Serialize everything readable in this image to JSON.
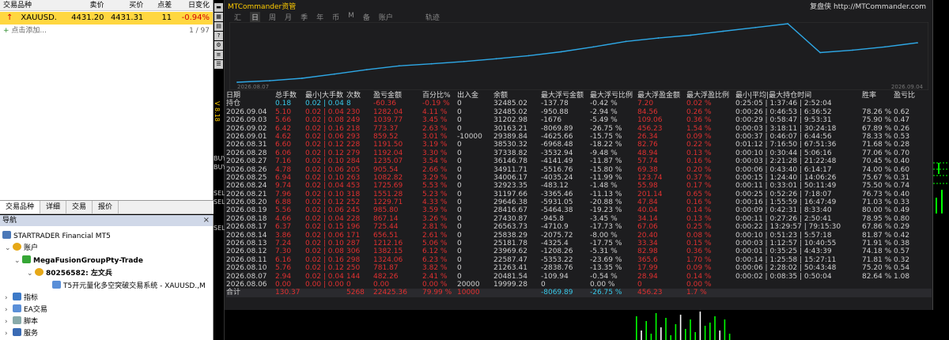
{
  "market_watch": {
    "columns": [
      "交易品种",
      "卖价",
      "买价",
      "点差",
      "日变化"
    ],
    "row": {
      "symbol": "XAUUSD.",
      "bid": "4431.20",
      "ask": "4431.31",
      "spread": "11",
      "change": "-0.94%"
    },
    "add_label": "点击添加...",
    "count": "1 / 97"
  },
  "tabs": [
    "交易品种",
    "详细",
    "交易",
    "报价"
  ],
  "navigator": {
    "title": "导航",
    "broker": "STARTRADER Financial MT5",
    "accounts": "账户",
    "server": "MegaFusionGroupPty-Trade",
    "account": "80256582: 左文兵",
    "ea_attached": "T5开元量化多空突破交易系统 - XAUUSD.,M",
    "indicators": "指标",
    "ea": "EA交易",
    "scripts": "脚本",
    "services": "服务"
  },
  "left_toolbar": {
    "version": "V 8.18",
    "labels": [
      "BUY",
      "BUY",
      "SEL",
      "SEL",
      "SEL"
    ]
  },
  "panel": {
    "title": "MTCommander资管",
    "brand": "复盘侠 http://MTCommander.com",
    "tabs": [
      "汇",
      "日",
      "周",
      "月",
      "季",
      "年",
      "币",
      "M",
      "备",
      "账户",
      "轨迹"
    ],
    "active_tab": "日",
    "curve_start": "2026.08.07",
    "curve_end": "2026.09.04"
  },
  "colors": {
    "accent": "#ffcc00",
    "cyan": "#38c8e8",
    "red": "#e03030",
    "curve": "#2ea8e6",
    "background": "#1d1d1f"
  },
  "chart_data": {
    "type": "line",
    "x": [
      "2026.08.06",
      "2026.08.07",
      "2026.08.10",
      "2026.08.11",
      "2026.08.12",
      "2026.08.13",
      "2026.08.14",
      "2026.08.17",
      "2026.08.18",
      "2026.08.19",
      "2026.08.20",
      "2026.08.21",
      "2026.08.24",
      "2026.08.25",
      "2026.08.26",
      "2026.08.27",
      "2026.08.28",
      "2026.08.31",
      "2026.09.01",
      "2026.09.02",
      "2026.09.03",
      "2026.09.04"
    ],
    "values": [
      19999.28,
      20481.54,
      21263.41,
      22587.47,
      23969.62,
      25181.78,
      25838.29,
      26563.73,
      27430.87,
      28416.67,
      29646.38,
      31197.66,
      32923.35,
      34006.17,
      34911.71,
      36146.78,
      37338.82,
      38530.32,
      29389.84,
      30163.21,
      31202.98,
      32485.02
    ],
    "title": "",
    "xlabel": "",
    "ylabel": ""
  },
  "table": {
    "headers": [
      "日期",
      "总手数",
      "最小|大手数",
      "次数",
      "盈亏金额",
      "百分比%",
      "出入金",
      "余额",
      "最大浮亏金额",
      "最大浮亏比例",
      "最大浮盈金额",
      "最大浮盈比例",
      "最小|平均|最大持仓时间",
      "胜率",
      "盈亏比"
    ],
    "rows": [
      [
        "持仓",
        "0.18",
        "0.02 | 0.04",
        "8",
        "-60.36",
        "-0.19 %",
        "0",
        "32485.02",
        "-137.78",
        "-0.42 %",
        "7.20",
        "0.02 %",
        "0:25:05 | 1:37:46 | 2:52:04",
        "",
        ""
      ],
      [
        "2026.09.04",
        "5.10",
        "0.02 | 0.04",
        "230",
        "1282.04",
        "4.11 %",
        "0",
        "32485.02",
        "-950.88",
        "-2.94 %",
        "84.56",
        "0.26 %",
        "0:00:26 | 0:46:53 | 6:36:52",
        "78.26 %",
        "0.62"
      ],
      [
        "2026.09.03",
        "5.66",
        "0.02 | 0.08",
        "249",
        "1039.77",
        "3.45 %",
        "0",
        "31202.98",
        "-1676",
        "-5.49 %",
        "109.06",
        "0.36 %",
        "0:00:29 | 0:58:47 | 9:53:31",
        "75.90 %",
        "0.47"
      ],
      [
        "2026.09.02",
        "6.42",
        "0.02 | 0.16",
        "218",
        "773.37",
        "2.63 %",
        "0",
        "30163.21",
        "-8069.89",
        "-26.75 %",
        "456.23",
        "1.54 %",
        "0:00:03 | 3:18:11 | 30:24:18",
        "67.89 %",
        "0.26"
      ],
      [
        "2026.09.01",
        "4.62",
        "0.02 | 0.06",
        "293",
        "859.52",
        "3.01 %",
        "-10000",
        "29389.84",
        "-4625.66",
        "-15.75 %",
        "26.34",
        "0.09 %",
        "0:00:37 | 0:46:07 | 6:44:56",
        "78.33 %",
        "0.53"
      ],
      [
        "2026.08.31",
        "6.60",
        "0.02 | 0.12",
        "228",
        "1191.50",
        "3.19 %",
        "0",
        "38530.32",
        "-6968.48",
        "-18.22 %",
        "82.76",
        "0.22 %",
        "0:01:12 | 7:16:50 | 67:51:36",
        "71.68 %",
        "0.28"
      ],
      [
        "2026.08.28",
        "6.06",
        "0.02 | 0.12",
        "279",
        "1192.04",
        "3.30 %",
        "0",
        "37338.82",
        "-3532.94",
        "-9.48 %",
        "48.94",
        "0.13 %",
        "0:00:10 | 0:30:44 | 5:06:16",
        "77.06 %",
        "0.70"
      ],
      [
        "2026.08.27",
        "7.16",
        "0.02 | 0.10",
        "284",
        "1235.07",
        "3.54 %",
        "0",
        "36146.78",
        "-4141.49",
        "-11.87 %",
        "57.74",
        "0.16 %",
        "0:00:03 | 2:21:28 | 21:22:48",
        "70.45 %",
        "0.40"
      ],
      [
        "2026.08.26",
        "4.78",
        "0.02 | 0.06",
        "205",
        "905.54",
        "2.66 %",
        "0",
        "34911.71",
        "-5516.76",
        "-15.80 %",
        "69.38",
        "0.20 %",
        "0:00:06 | 0:43:40 | 6:14:17",
        "74.00 %",
        "0.60"
      ],
      [
        "2026.08.25",
        "6.94",
        "0.02 | 0.10",
        "263",
        "1082.82",
        "3.29 %",
        "0",
        "34006.17",
        "-4035.24",
        "-11.99 %",
        "123.74",
        "0.37 %",
        "0:00:15 | 1:24:40 | 14:06:26",
        "75.67 %",
        "0.31"
      ],
      [
        "2026.08.24",
        "9.74",
        "0.02 | 0.04",
        "453",
        "1725.69",
        "5.53 %",
        "0",
        "32923.35",
        "-483.12",
        "-1.48 %",
        "55.98",
        "0.17 %",
        "0:00:11 | 0:33:01 | 50:11:49",
        "75.50 %",
        "0.74"
      ],
      [
        "2026.08.21",
        "7.96",
        "0.02 | 0.10",
        "318",
        "1551.28",
        "5.23 %",
        "0",
        "31197.66",
        "-3365.46",
        "-11.13 %",
        "201.14",
        "0.65 %",
        "0:00:25 | 0:52:26 | 7:18:07",
        "76.73 %",
        "0.40"
      ],
      [
        "2026.08.20",
        "6.88",
        "0.02 | 0.12",
        "252",
        "1229.71",
        "4.33 %",
        "0",
        "29646.38",
        "-5931.05",
        "-20.88 %",
        "47.84",
        "0.16 %",
        "0:00:16 | 1:55:59 | 16:47:49",
        "71.03 %",
        "0.33"
      ],
      [
        "2026.08.19",
        "5.56",
        "0.02 | 0.06",
        "245",
        "985.80",
        "3.59 %",
        "0",
        "28416.67",
        "-5464.38",
        "-19.23 %",
        "40.04",
        "0.14 %",
        "0:00:09 | 0:42:31 | 8:33:40",
        "80.00 %",
        "0.49"
      ],
      [
        "2026.08.18",
        "4.66",
        "0.02 | 0.04",
        "228",
        "867.14",
        "3.26 %",
        "0",
        "27430.87",
        "-945.8",
        "-3.45 %",
        "34.14",
        "0.13 %",
        "0:00:11 | 0:27:26 | 2:50:41",
        "78.95 %",
        "0.80"
      ],
      [
        "2026.08.17",
        "6.37",
        "0.02 | 0.15",
        "196",
        "725.44",
        "2.81 %",
        "0",
        "26563.73",
        "-4710.9",
        "-17.73 %",
        "67.06",
        "0.25 %",
        "0:00:22 | 13:29:57 | 79:15:30",
        "67.86 %",
        "0.29"
      ],
      [
        "2026.08.14",
        "3.86",
        "0.02 | 0.06",
        "171",
        "656.51",
        "2.61 %",
        "0",
        "25838.29",
        "-2075.72",
        "-8.00 %",
        "20.40",
        "0.08 %",
        "0:00:10 | 0:51:23 | 5:57:18",
        "81.87 %",
        "0.42"
      ],
      [
        "2026.08.13",
        "7.24",
        "0.02 | 0.10",
        "287",
        "1212.16",
        "5.06 %",
        "0",
        "25181.78",
        "-4325.4",
        "-17.75 %",
        "33.34",
        "0.15 %",
        "0:00:03 | 1:12:57 | 10:40:55",
        "71.91 %",
        "0.38"
      ],
      [
        "2026.08.12",
        "7.30",
        "0.02 | 0.08",
        "306",
        "1382.15",
        "6.12 %",
        "0",
        "23969.62",
        "-1208.26",
        "-5.31 %",
        "82.98",
        "0.36 %",
        "0:00:01 | 0:35:25 | 4:43:39",
        "74.18 %",
        "0.57"
      ],
      [
        "2026.08.11",
        "6.16",
        "0.02 | 0.16",
        "298",
        "1324.06",
        "6.23 %",
        "0",
        "22587.47",
        "-5353.22",
        "-23.69 %",
        "365.6",
        "1.70 %",
        "0:00:14 | 1:25:58 | 15:27:11",
        "71.81 %",
        "0.32"
      ],
      [
        "2026.08.10",
        "5.76",
        "0.02 | 0.12",
        "250",
        "781.87",
        "3.82 %",
        "0",
        "21263.41",
        "-2838.76",
        "-13.35 %",
        "17.99",
        "0.09 %",
        "0:00:06 | 2:28:02 | 50:43:48",
        "75.20 %",
        "0.54"
      ],
      [
        "2026.08.07",
        "2.94",
        "0.02 | 0.04",
        "144",
        "482.26",
        "2.41 %",
        "0",
        "20481.54",
        "-109.94",
        "-0.54 %",
        "28.94",
        "0.14 %",
        "0:00:02 | 0:08:35 | 0:50:04",
        "82.64 %",
        "1.08"
      ],
      [
        "2026.08.06",
        "0.00",
        "0.00 | 0.00",
        "0",
        "0.00",
        "0.00 %",
        "20000",
        "19999.28",
        "0",
        "0.00 %",
        "0",
        "0.00 %",
        "",
        "",
        ""
      ]
    ],
    "summary": [
      "合计",
      "130.37",
      "",
      "5268",
      "22425.36",
      "79.99 %",
      "10000",
      "",
      "-8069.89",
      "-26.75 %",
      "456.23",
      "1.7 %",
      "",
      "",
      ""
    ]
  }
}
